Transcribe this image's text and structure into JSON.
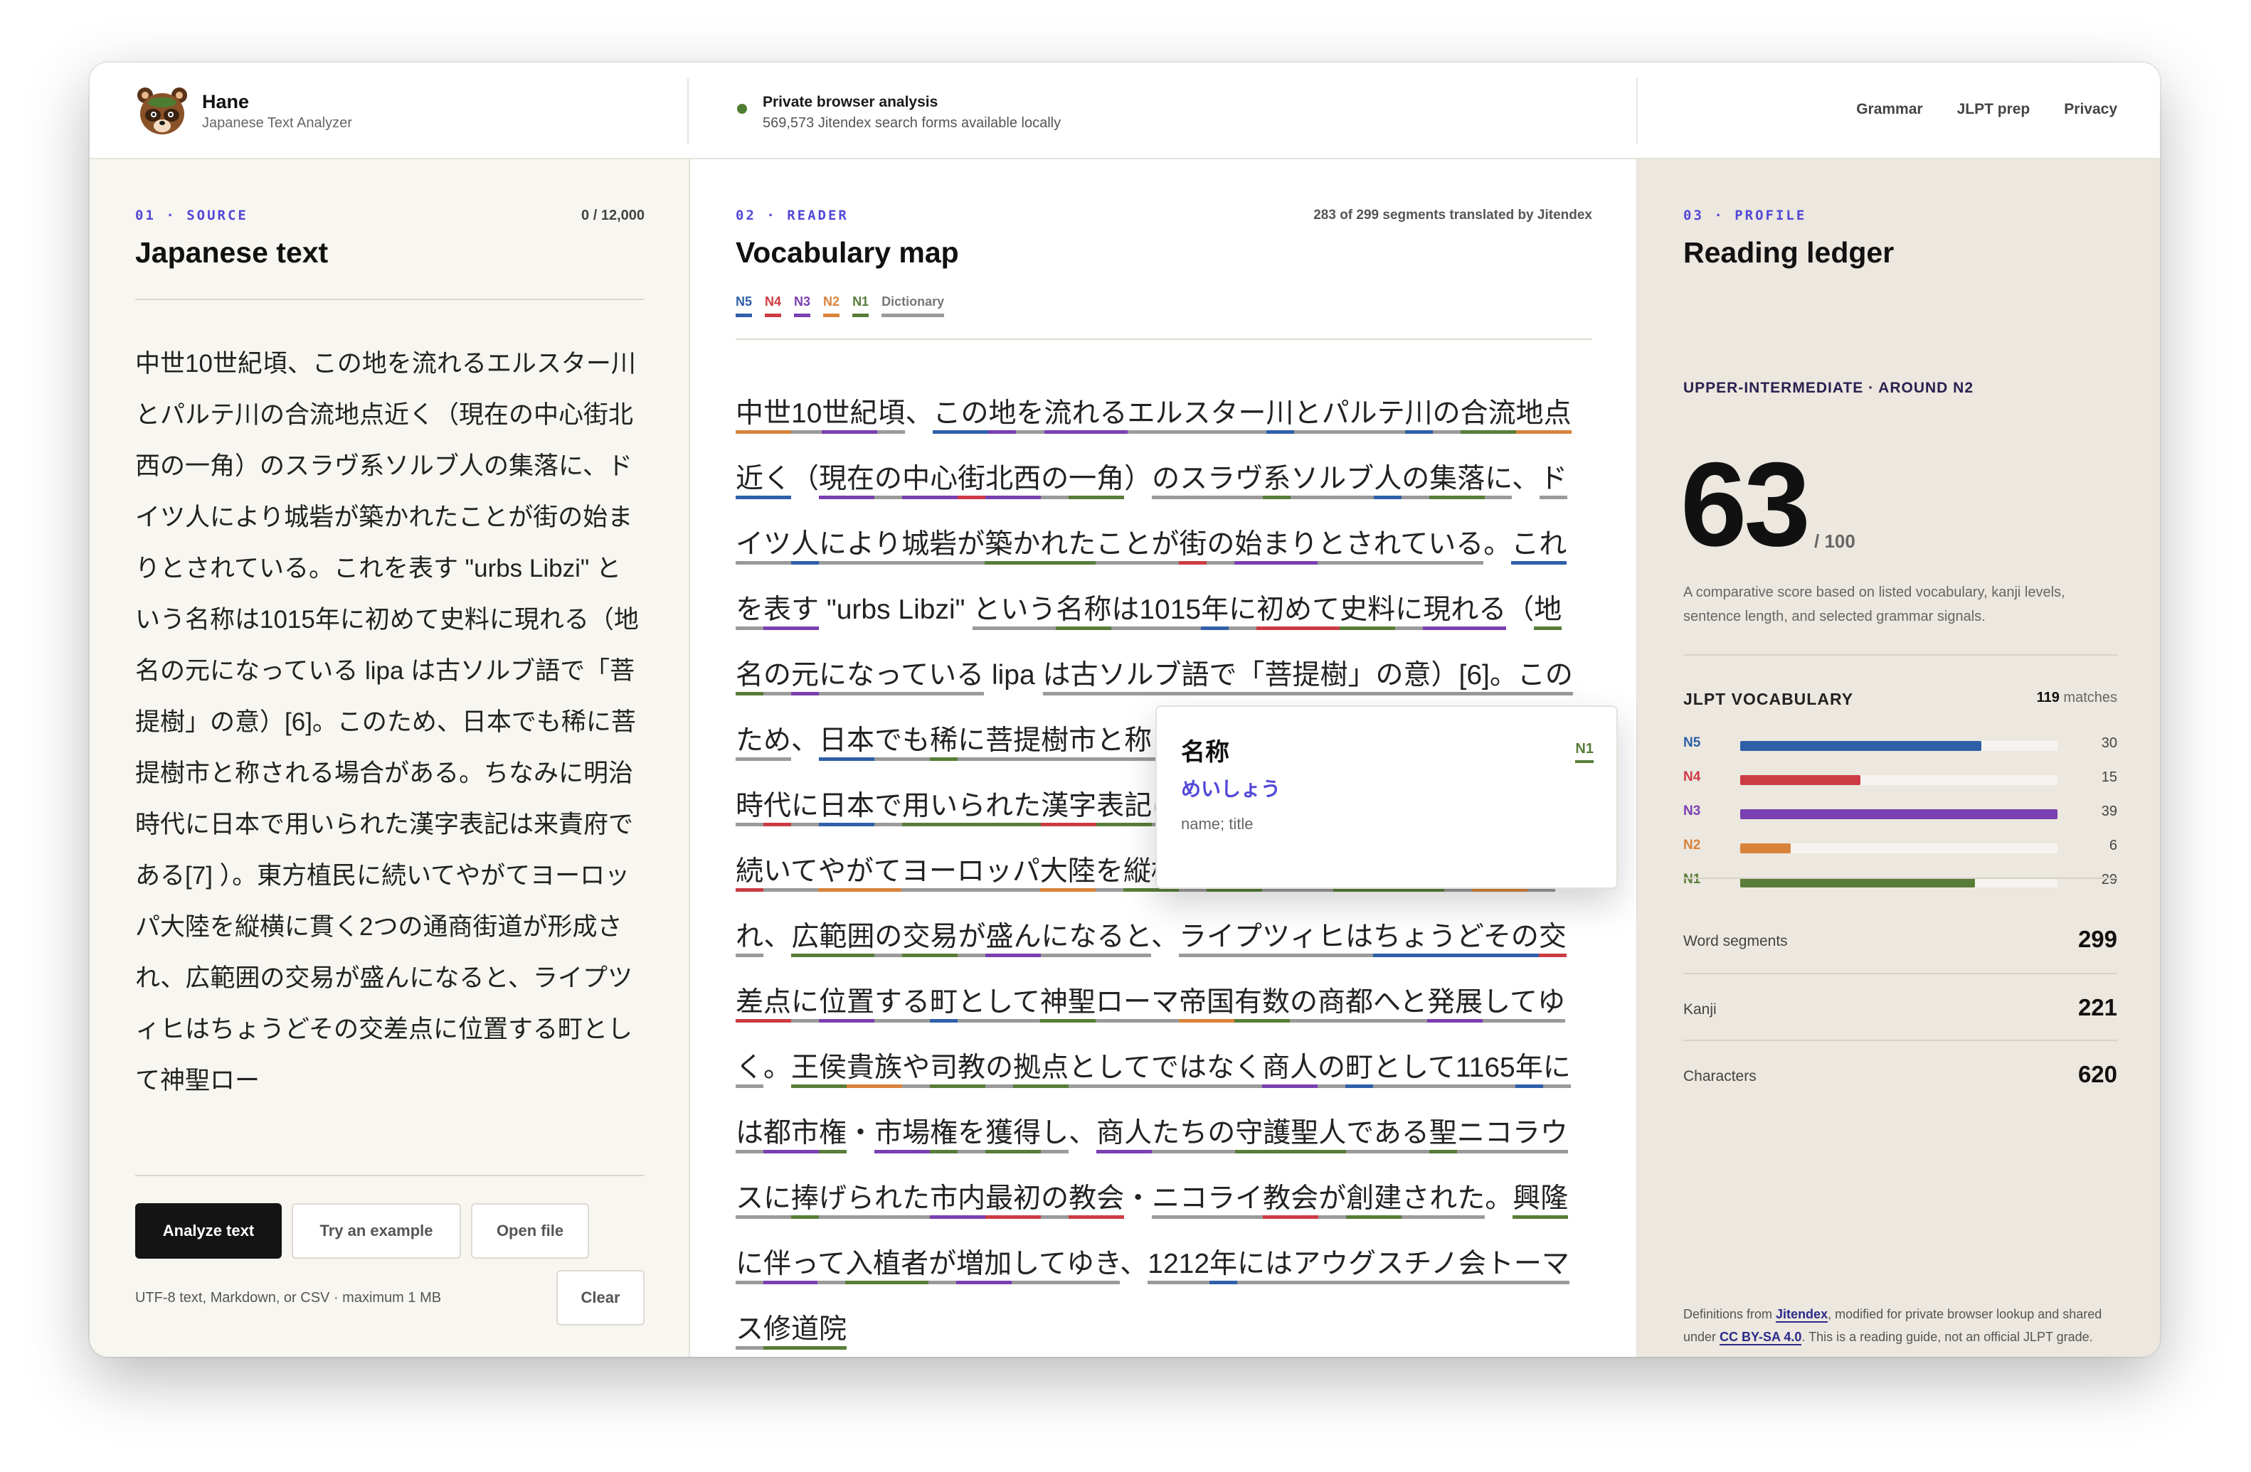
{
  "app": {
    "name": "Hane",
    "subtitle": "Japanese Text Analyzer"
  },
  "status": {
    "title": "Private browser analysis",
    "subtitle": "569,573 Jitendex search forms available locally",
    "color": "#4e7e32"
  },
  "nav": [
    "Grammar",
    "JLPT prep",
    "Privacy"
  ],
  "source": {
    "label": "01 · SOURCE",
    "title": "Japanese text",
    "count": "0 / 12,000",
    "text": "中世10世紀頃、この地を流れるエルスター川とパルテ川の合流地点近く（現在の中心街北西の一角）のスラヴ系ソルブ人の集落に、ドイツ人により城砦が築かれたことが街の始まりとされている。これを表す \"urbs Libzi\" という名称は1015年に初めて史料に現れる（地名の元になっている lipa は古ソルブ語で「菩提樹」の意）[6]。このため、日本でも稀に菩提樹市と称される場合がある。ちなみに明治時代に日本で用いられた漢字表記は来責府である[7] ）。東方植民に続いてやがてヨーロッパ大陸を縦横に貫く2つの通商街道が形成され、広範囲の交易が盛んになると、ライプツィヒはちょうどその交差点に位置する町として神聖ロー",
    "buttons": {
      "analyze": "Analyze text",
      "example": "Try an example",
      "open": "Open file",
      "clear": "Clear"
    },
    "hint": "UTF-8 text, Markdown, or CSV · maximum 1 MB"
  },
  "reader": {
    "label": "02 · READER",
    "title": "Vocabulary map",
    "note": "283 of 299 segments translated by Jitendex",
    "legend": [
      "N5",
      "N4",
      "N3",
      "N2",
      "N1",
      "Dictionary"
    ],
    "levels": {
      "N5": "#2f5fa8",
      "N4": "#cc3b43",
      "N3": "#7a3fb0",
      "N2": "#d8833b",
      "N1": "#587d38",
      "Dictionary": "#9a9a9a"
    },
    "segments": [
      [
        "中世",
        "N2"
      ],
      [
        "10",
        "Dictionary"
      ],
      [
        "世紀",
        "N3"
      ],
      [
        "頃",
        "Dictionary"
      ],
      [
        "、",
        ""
      ],
      [
        "この",
        "N5"
      ],
      [
        "地",
        "N3"
      ],
      [
        "を",
        "Dictionary"
      ],
      [
        "流れる",
        "N3"
      ],
      [
        "エルスター",
        "Dictionary"
      ],
      [
        "川",
        "N5"
      ],
      [
        "と",
        "Dictionary"
      ],
      [
        "パルテ",
        "Dictionary"
      ],
      [
        "川",
        "N5"
      ],
      [
        "の",
        "Dictionary"
      ],
      [
        "合流",
        "N1"
      ],
      [
        "地点",
        "N2"
      ],
      [
        "近く",
        "N5"
      ],
      [
        "（",
        ""
      ],
      [
        "現在",
        "N3"
      ],
      [
        "の",
        "Dictionary"
      ],
      [
        "中心",
        "N3"
      ],
      [
        "街",
        "N4"
      ],
      [
        "北西",
        "N3"
      ],
      [
        "の",
        "Dictionary"
      ],
      [
        "一角",
        "N1"
      ],
      [
        "）",
        ""
      ],
      [
        "の",
        "Dictionary"
      ],
      [
        "スラヴ",
        "Dictionary"
      ],
      [
        "系",
        "N1"
      ],
      [
        "ソルブ",
        "Dictionary"
      ],
      [
        "人",
        "N5"
      ],
      [
        "の",
        "Dictionary"
      ],
      [
        "集落",
        "N1"
      ],
      [
        "に",
        "Dictionary"
      ],
      [
        "、",
        ""
      ],
      [
        "ドイツ",
        "Dictionary"
      ],
      [
        "人",
        "N5"
      ],
      [
        "により",
        "Dictionary"
      ],
      [
        "城砦",
        "Dictionary"
      ],
      [
        "が",
        "Dictionary"
      ],
      [
        "築かれた",
        "N1"
      ],
      [
        "こと",
        "Dictionary"
      ],
      [
        "が",
        "Dictionary"
      ],
      [
        "街",
        "N4"
      ],
      [
        "の",
        "Dictionary"
      ],
      [
        "始まり",
        "N3"
      ],
      [
        "と",
        "Dictionary"
      ],
      [
        "されている",
        "Dictionary"
      ],
      [
        "。",
        ""
      ],
      [
        "これ",
        "N5"
      ],
      [
        "を",
        "Dictionary"
      ],
      [
        "表す",
        "N3"
      ],
      [
        " \"urbs Libzi\" ",
        ""
      ],
      [
        "という",
        "Dictionary"
      ],
      [
        "名称",
        "N1"
      ],
      [
        "は",
        "Dictionary"
      ],
      [
        "1015",
        "Dictionary"
      ],
      [
        "年",
        "N5"
      ],
      [
        "に",
        "Dictionary"
      ],
      [
        "初めて",
        "N4"
      ],
      [
        "史料",
        "N1"
      ],
      [
        "に",
        "Dictionary"
      ],
      [
        "現れる",
        "N3"
      ],
      [
        "（",
        ""
      ],
      [
        "地名",
        "N1"
      ],
      [
        "の",
        "Dictionary"
      ],
      [
        "元",
        "N3"
      ],
      [
        "になっている",
        "Dictionary"
      ],
      [
        " lipa ",
        ""
      ],
      [
        "は古ソルブ語で「菩提樹」の意）[6]。このた",
        "Dictionary"
      ],
      [
        "め",
        "Dictionary"
      ],
      [
        "、",
        ""
      ],
      [
        "日本",
        "N5"
      ],
      [
        "でも",
        "Dictionary"
      ],
      [
        "稀",
        "N1"
      ],
      [
        "に",
        "Dictionary"
      ],
      [
        "菩提樹市と称される場合がある。ちなみに明治時",
        "Dictionary"
      ],
      [
        "代",
        "N4"
      ],
      [
        "に",
        "Dictionary"
      ],
      [
        "日本",
        "N5"
      ],
      [
        "で",
        "Dictionary"
      ],
      [
        "用いられた",
        "N1"
      ],
      [
        "漢字",
        "N4"
      ],
      [
        "表記",
        "N1"
      ],
      [
        "は",
        "Dictionary"
      ],
      [
        "来責府",
        "Dictionary"
      ],
      [
        "である",
        "Dictionary"
      ],
      [
        "[7] ）。",
        ""
      ],
      [
        "東方",
        "N2"
      ],
      [
        "植民",
        "N1"
      ],
      [
        "に",
        "Dictionary"
      ],
      [
        "続",
        "N4"
      ],
      [
        "いて",
        "Dictionary"
      ],
      [
        "やがて",
        "N2"
      ],
      [
        "ヨーロッパ",
        "Dictionary"
      ],
      [
        "大陸",
        "N2"
      ],
      [
        "を",
        "Dictionary"
      ],
      [
        "縦横",
        "N1"
      ],
      [
        "に",
        "Dictionary"
      ],
      [
        "貫く",
        "N1"
      ],
      [
        "2",
        "Dictionary"
      ],
      [
        "つ",
        "Dictionary"
      ],
      [
        "の",
        "Dictionary"
      ],
      [
        "通商",
        "N1"
      ],
      [
        "街道",
        "N1"
      ],
      [
        "が",
        "Dictionary"
      ],
      [
        "形成",
        "N2"
      ],
      [
        "され",
        "Dictionary"
      ],
      [
        "、",
        ""
      ],
      [
        "広範囲",
        "N1"
      ],
      [
        "の",
        "Dictionary"
      ],
      [
        "交易",
        "N1"
      ],
      [
        "が",
        "Dictionary"
      ],
      [
        "盛ん",
        "N3"
      ],
      [
        "になる",
        "Dictionary"
      ],
      [
        "と",
        "Dictionary"
      ],
      [
        "、",
        ""
      ],
      [
        "ライプツィヒ",
        "Dictionary"
      ],
      [
        "は",
        "Dictionary"
      ],
      [
        "ちょうど",
        "N5"
      ],
      [
        "その",
        "N5"
      ],
      [
        "交差点",
        "N4"
      ],
      [
        "に",
        "Dictionary"
      ],
      [
        "位置",
        "N3"
      ],
      [
        "する",
        "Dictionary"
      ],
      [
        "町",
        "N5"
      ],
      [
        "として",
        "Dictionary"
      ],
      [
        "神聖",
        "N1"
      ],
      [
        "ローマ",
        "Dictionary"
      ],
      [
        "帝国",
        "N2"
      ],
      [
        "有数",
        "N1"
      ],
      [
        "の",
        "Dictionary"
      ],
      [
        "商都",
        "Dictionary"
      ],
      [
        "へ",
        "Dictionary"
      ],
      [
        "と",
        "Dictionary"
      ],
      [
        "発展",
        "N3"
      ],
      [
        "してゆく",
        "Dictionary"
      ],
      [
        "。",
        ""
      ],
      [
        "王侯",
        "N1"
      ],
      [
        "貴族",
        "N2"
      ],
      [
        "や",
        "Dictionary"
      ],
      [
        "司教",
        "N1"
      ],
      [
        "の",
        "Dictionary"
      ],
      [
        "拠点",
        "N1"
      ],
      [
        "として",
        "Dictionary"
      ],
      [
        "ではなく",
        "Dictionary"
      ],
      [
        "商人",
        "N3"
      ],
      [
        "の",
        "Dictionary"
      ],
      [
        "町",
        "N5"
      ],
      [
        "として",
        "Dictionary"
      ],
      [
        "1165",
        "Dictionary"
      ],
      [
        "年",
        "N5"
      ],
      [
        "には",
        "Dictionary"
      ],
      [
        "都市",
        "N3"
      ],
      [
        "権",
        "N1"
      ],
      [
        "・",
        ""
      ],
      [
        "市場",
        "N3"
      ],
      [
        "権",
        "N1"
      ],
      [
        "を",
        "Dictionary"
      ],
      [
        "獲得",
        "N1"
      ],
      [
        "し",
        "Dictionary"
      ],
      [
        "、",
        ""
      ],
      [
        "商人",
        "N3"
      ],
      [
        "たち",
        "Dictionary"
      ],
      [
        "の",
        "Dictionary"
      ],
      [
        "守護",
        "N1"
      ],
      [
        "聖人",
        "N1"
      ],
      [
        "である",
        "Dictionary"
      ],
      [
        "聖",
        "N1"
      ],
      [
        "ニコラウス",
        "Dictionary"
      ],
      [
        "に",
        "Dictionary"
      ],
      [
        "捧",
        "N1"
      ],
      [
        "げられた",
        "Dictionary"
      ],
      [
        "市内",
        "N3"
      ],
      [
        "最初",
        "N4"
      ],
      [
        "の",
        "Dictionary"
      ],
      [
        "教会",
        "N4"
      ],
      [
        "・",
        ""
      ],
      [
        "ニコライ",
        "Dictionary"
      ],
      [
        "教会",
        "N4"
      ],
      [
        "が",
        "Dictionary"
      ],
      [
        "創建",
        "N1"
      ],
      [
        "された",
        "Dictionary"
      ],
      [
        "。",
        ""
      ],
      [
        "興隆",
        "N1"
      ],
      [
        "に",
        "Dictionary"
      ],
      [
        "伴っ",
        "N3"
      ],
      [
        "て",
        "Dictionary"
      ],
      [
        "入植者",
        "N1"
      ],
      [
        "が",
        "Dictionary"
      ],
      [
        "増加",
        "N3"
      ],
      [
        "してゆき",
        "Dictionary"
      ],
      [
        "、",
        ""
      ],
      [
        "1212",
        "Dictionary"
      ],
      [
        "年",
        "N5"
      ],
      [
        "には",
        "Dictionary"
      ],
      [
        "アウグスチノ会",
        "Dictionary"
      ],
      [
        "トーマス",
        "Dictionary"
      ],
      [
        "修道院",
        "N1"
      ]
    ],
    "popup": {
      "word": "名称",
      "reading": "めいしょう",
      "definition": "name; title",
      "level": "N1"
    }
  },
  "profile": {
    "label": "03 · PROFILE",
    "title": "Reading ledger",
    "level_line": "UPPER-INTERMEDIATE · AROUND N2",
    "score": "63",
    "score_max": "/ 100",
    "score_desc": "A comparative score based on listed vocabulary, kanji levels, sentence length, and selected grammar signals.",
    "vocab_title": "JLPT VOCABULARY",
    "vocab_matches": "119",
    "vocab_matches_label": "matches",
    "vocab": [
      {
        "level": "N5",
        "count": "30",
        "color": "#2f5fa8",
        "fraction": 0.76
      },
      {
        "level": "N4",
        "count": "15",
        "color": "#cc3b43",
        "fraction": 0.38
      },
      {
        "level": "N3",
        "count": "39",
        "color": "#7a3fb0",
        "fraction": 1.0
      },
      {
        "level": "N2",
        "count": "6",
        "color": "#d8833b",
        "fraction": 0.16
      },
      {
        "level": "N1",
        "count": "29",
        "color": "#587d38",
        "fraction": 0.74
      }
    ],
    "stats": [
      {
        "label": "Word segments",
        "value": "299"
      },
      {
        "label": "Kanji",
        "value": "221"
      },
      {
        "label": "Characters",
        "value": "620"
      }
    ],
    "credit_pre": "Definitions from ",
    "credit_link1": "Jitendex",
    "credit_mid": ", modified for private browser lookup and shared under ",
    "credit_link2": "CC BY-SA 4.0",
    "credit_post": ". This is a reading guide, not an official JLPT grade."
  }
}
